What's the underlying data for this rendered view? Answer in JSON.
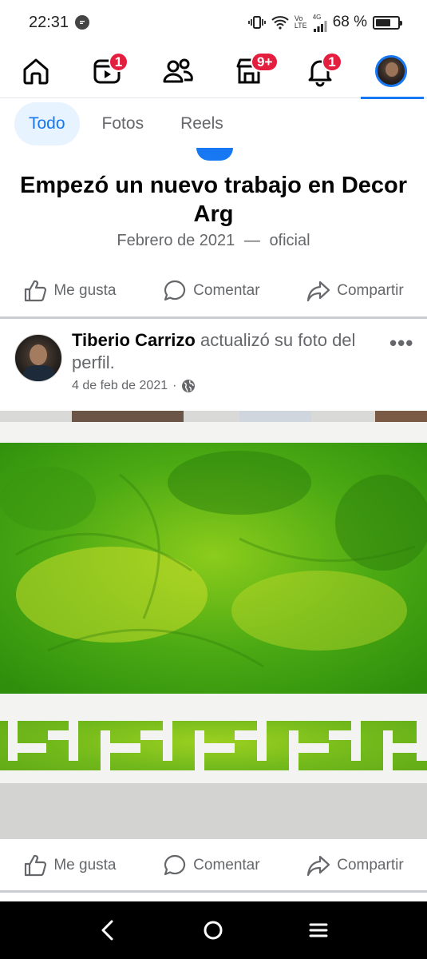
{
  "status_bar": {
    "time": "22:31",
    "network_top": "Vo",
    "network_bottom": "LTE",
    "network_gen": "4G",
    "battery": "68 %",
    "battery_level": 0.68
  },
  "top_nav": {
    "items": [
      {
        "name": "home",
        "icon": "home-icon",
        "badge": ""
      },
      {
        "name": "video",
        "icon": "video-icon",
        "badge": "1"
      },
      {
        "name": "friends",
        "icon": "friends-icon",
        "badge": ""
      },
      {
        "name": "marketplace",
        "icon": "marketplace-icon",
        "badge": "9+"
      },
      {
        "name": "notifications",
        "icon": "bell-icon",
        "badge": "1"
      },
      {
        "name": "profile",
        "icon": "avatar",
        "badge": ""
      }
    ],
    "accent": "#1877f2",
    "badge_color": "#e41e3f"
  },
  "filters": {
    "all": "Todo",
    "photos": "Fotos",
    "reels": "Reels"
  },
  "life_event": {
    "title": "Empezó un nuevo trabajo en Decor Arg",
    "date": "Febrero de 2021",
    "separator": "—",
    "role": "oficial"
  },
  "actions": {
    "like": "Me gusta",
    "comment": "Comentar",
    "share": "Compartir"
  },
  "post": {
    "author": "Tiberio Carrizo",
    "action_text": " actualizó su foto del perfil.",
    "date": "4 de feb de 2021",
    "meta_separator": "·",
    "privacy_icon": "globe-icon",
    "more": "•••"
  }
}
